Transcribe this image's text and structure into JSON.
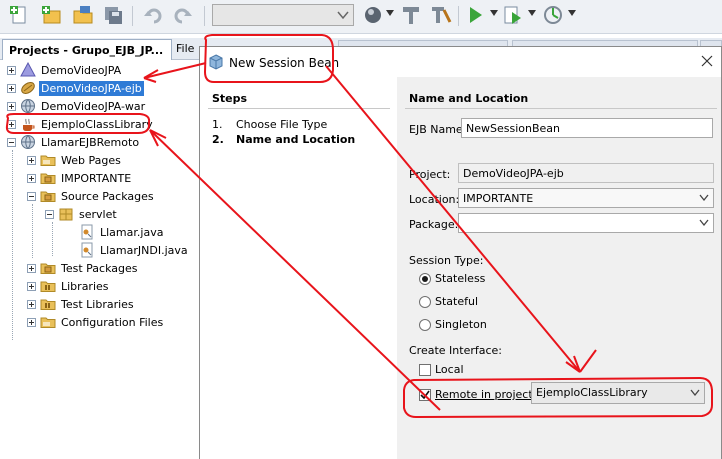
{
  "toolbar": {
    "buttons": [
      "new-file-icon",
      "new-project-icon",
      "open-project-icon",
      "save-all-icon",
      "undo-icon",
      "redo-icon",
      "build-icon",
      "clean-build-icon",
      "run-icon",
      "debug-icon",
      "profile-icon"
    ],
    "config_combo_value": ""
  },
  "tabs": {
    "projects": "Projects - Grupo_EJB_JP...",
    "files": "File"
  },
  "tree": {
    "items": [
      {
        "label": "DemoVideoJPA",
        "icon": "jpa-project-icon",
        "level": 0,
        "expander": "plus"
      },
      {
        "label": "DemoVideoJPA-ejb",
        "icon": "ejb-module-icon",
        "level": 0,
        "expander": "plus",
        "selected": true
      },
      {
        "label": "DemoVideoJPA-war",
        "icon": "web-app-icon",
        "level": 0,
        "expander": "plus"
      },
      {
        "label": "EjemploClassLibrary",
        "icon": "class-library-icon",
        "level": 0,
        "expander": "plus"
      },
      {
        "label": "LlamarEJBRemoto",
        "icon": "web-app-icon",
        "level": 0,
        "expander": "minus"
      },
      {
        "label": "Web Pages",
        "icon": "folder-icon",
        "level": 1,
        "expander": "plus"
      },
      {
        "label": "IMPORTANTE",
        "icon": "package-folder-icon",
        "level": 1,
        "expander": "plus"
      },
      {
        "label": "Source Packages",
        "icon": "package-folder-icon",
        "level": 1,
        "expander": "minus"
      },
      {
        "label": "servlet",
        "icon": "package-icon",
        "level": 2,
        "expander": "minus"
      },
      {
        "label": "Llamar.java",
        "icon": "java-file-icon",
        "level": 3,
        "expander": "none"
      },
      {
        "label": "LlamarJNDI.java",
        "icon": "java-file-icon",
        "level": 3,
        "expander": "none"
      },
      {
        "label": "Test Packages",
        "icon": "package-folder-icon",
        "level": 1,
        "expander": "plus"
      },
      {
        "label": "Libraries",
        "icon": "library-folder-icon",
        "level": 1,
        "expander": "plus"
      },
      {
        "label": "Test Libraries",
        "icon": "library-folder-icon",
        "level": 1,
        "expander": "plus"
      },
      {
        "label": "Configuration Files",
        "icon": "folder-icon",
        "level": 1,
        "expander": "plus"
      }
    ]
  },
  "dialog": {
    "title": "New Session Bean",
    "steps_heading": "Steps",
    "steps": [
      {
        "num": "1.",
        "label": "Choose File Type",
        "current": false
      },
      {
        "num": "2.",
        "label": "Name and Location",
        "current": true
      }
    ],
    "section_heading": "Name and Location",
    "ejb_name_label": "EJB Name:",
    "ejb_name_value": "NewSessionBean",
    "project_label": "Project:",
    "project_value": "DemoVideoJPA-ejb",
    "location_label": "Location:",
    "location_value": "IMPORTANTE",
    "package_label": "Package:",
    "package_value": "",
    "session_type_label": "Session Type:",
    "session_types": [
      {
        "label": "Stateless",
        "selected": true
      },
      {
        "label": "Stateful",
        "selected": false
      },
      {
        "label": "Singleton",
        "selected": false
      }
    ],
    "create_interface_label": "Create Interface:",
    "local_label": "Local",
    "local_checked": false,
    "remote_label": "Remote in project:",
    "remote_checked": true,
    "remote_project_value": "EjemploClassLibrary"
  },
  "colors": {
    "annotation": "#e8141b",
    "selection": "#2f7bd6"
  }
}
